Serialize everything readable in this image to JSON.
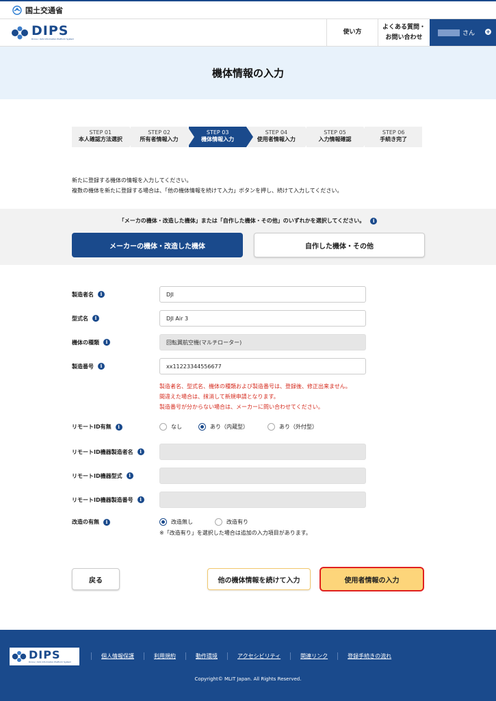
{
  "gov": {
    "ministry": "国土交通省"
  },
  "header": {
    "logo_text": "DIPS",
    "logo_sub": "Drone / UAS Information Platform System",
    "howto": "使い方",
    "faq_line1": "よくある質問・",
    "faq_line2": "お問い合わせ",
    "user_suffix": "さん"
  },
  "page": {
    "title": "機体情報の入力"
  },
  "steps": [
    {
      "num": "STEP 01",
      "label": "本人確認方法選択"
    },
    {
      "num": "STEP 02",
      "label": "所有者情報入力"
    },
    {
      "num": "STEP 03",
      "label": "機体情報入力"
    },
    {
      "num": "STEP 04",
      "label": "使用者情報入力"
    },
    {
      "num": "STEP 05",
      "label": "入力情報確認"
    },
    {
      "num": "STEP 06",
      "label": "手続き完了"
    }
  ],
  "active_step": "STEP 03",
  "intro": {
    "line1": "新たに登録する機体の情報を入力してください。",
    "line2": "複数の機体を新たに登録する場合は、「他の機体情報を続けて入力」ボタンを押し、続けて入力してください。"
  },
  "choice": {
    "question": "「メーカの機体・改造した機体」または「自作した機体・その他」のいずれかを選択してください。",
    "selected": "メーカーの機体・改造した機体",
    "other": "自作した機体・その他"
  },
  "form": {
    "maker_label": "製造者名",
    "maker_value": "DJI",
    "model_label": "型式名",
    "model_value": "DJI Air 3",
    "type_label": "機体の種類",
    "type_value": "回転翼航空機(マルチローター)",
    "serial_label": "製造番号",
    "serial_value": "xx11223344556677",
    "warn1": "製造者名、型式名、機体の種類および製造番号は、登録後、修正出来ません。",
    "warn2": "間違えた場合は、抹消して新規申請となります。",
    "warn3": "製造番号が分からない場合は、メーカーに問い合わせてください。",
    "remote_label": "リモートID有無",
    "remote_opt1": "なし",
    "remote_opt2": "あり（内蔵型）",
    "remote_opt3": "あり（外付型）",
    "remote_selected": "あり（内蔵型）",
    "rid_maker_label": "リモートID機器製造者名",
    "rid_model_label": "リモートID機器型式",
    "rid_serial_label": "リモートID機器製造番号",
    "mod_label": "改造の有無",
    "mod_opt1": "改造無し",
    "mod_opt2": "改造有り",
    "mod_selected": "改造無し",
    "mod_note": "※「改造有り」を選択した場合は追加の入力項目があります。"
  },
  "buttons": {
    "back": "戻る",
    "more": "他の機体情報を続けて入力",
    "next": "使用者情報の入力"
  },
  "footer": {
    "links": [
      "個人情報保護",
      "利用規約",
      "動作環境",
      "アクセシビリティ",
      "関連リンク",
      "登録手続きの流れ"
    ],
    "copyright": "Copyright© MLIT Japan. All Rights Reserved."
  },
  "colors": {
    "brand": "#1a4a8c",
    "warning": "#d52b1e",
    "cta": "#fdd57a",
    "cta_border": "#e02020"
  }
}
